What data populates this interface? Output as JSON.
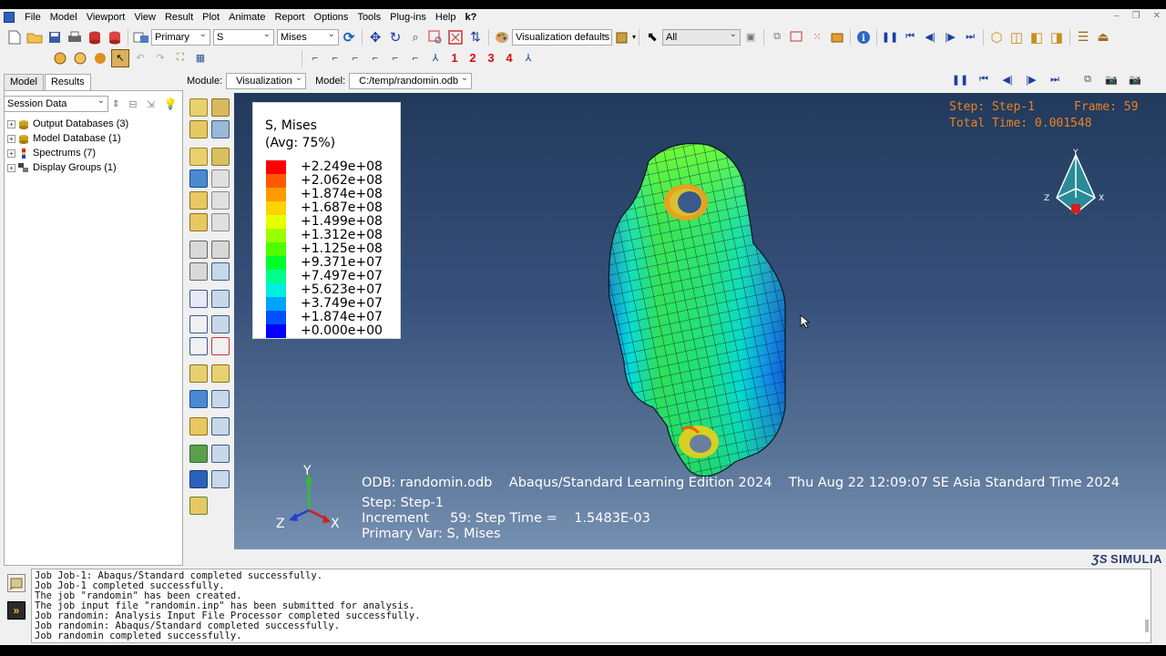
{
  "menu": [
    "File",
    "Model",
    "Viewport",
    "View",
    "Result",
    "Plot",
    "Animate",
    "Report",
    "Options",
    "Tools",
    "Plug-ins",
    "Help"
  ],
  "toolbar": {
    "primary_select": "Primary",
    "variable_select": "S",
    "invariant_select": "Mises",
    "viz_defaults": "Visualization defaults",
    "selection_filter": "All",
    "red_numbers": [
      "1",
      "2",
      "3",
      "4"
    ]
  },
  "left_tabs": {
    "model": "Model",
    "results": "Results"
  },
  "session_select": "Session Data",
  "tree": [
    {
      "label": "Output Databases (3)",
      "icon": "database-icon"
    },
    {
      "label": "Model Database (1)",
      "icon": "database-icon"
    },
    {
      "label": "Spectrums (7)",
      "icon": "spectrum-icon"
    },
    {
      "label": "Display Groups (1)",
      "icon": "display-groups-icon"
    }
  ],
  "module_row": {
    "module_label": "Module:",
    "module_value": "Visualization",
    "model_label": "Model:",
    "model_value": "C:/temp/randomin.odb"
  },
  "legend": {
    "title": "S, Mises",
    "subtitle": "(Avg: 75%)",
    "entries": [
      {
        "value": "+2.249e+08",
        "color": "#ff0000"
      },
      {
        "value": "+2.062e+08",
        "color": "#ff5a00"
      },
      {
        "value": "+1.874e+08",
        "color": "#ff9a00"
      },
      {
        "value": "+1.687e+08",
        "color": "#ffd200"
      },
      {
        "value": "+1.499e+08",
        "color": "#e6ff00"
      },
      {
        "value": "+1.312e+08",
        "color": "#9cff00"
      },
      {
        "value": "+1.125e+08",
        "color": "#4dff00"
      },
      {
        "value": "+9.371e+07",
        "color": "#00ff2a"
      },
      {
        "value": "+7.497e+07",
        "color": "#00ff8a"
      },
      {
        "value": "+5.623e+07",
        "color": "#00f0e0"
      },
      {
        "value": "+3.749e+07",
        "color": "#00a4ff"
      },
      {
        "value": "+1.874e+07",
        "color": "#0050ff"
      },
      {
        "value": "+0.000e+00",
        "color": "#0000ff"
      }
    ]
  },
  "step_info": {
    "step": "Step: Step-1",
    "frame": "Frame: 59",
    "total_time": "Total Time: 0.001548"
  },
  "triad_small": {
    "y": "Y",
    "z": "Z",
    "x": "X"
  },
  "triad": {
    "y": "Y",
    "z": "Z",
    "x": "X"
  },
  "odb_line": "ODB: randomin.odb    Abaqus/Standard Learning Edition 2024    Thu Aug 22 12:09:07 SE Asia Standard Time 2024",
  "step_line": "Step: Step-1",
  "increment_line": "Increment     59: Step Time =    1.5483E-03",
  "primary_var_line": "Primary Var: S, Mises",
  "brand": "SIMULIA",
  "messages": [
    "Job Job-1: Abaqus/Standard completed successfully.",
    "Job Job-1 completed successfully.",
    "The job \"randomin\" has been created.",
    "The job input file \"randomin.inp\" has been submitted for analysis.",
    "Job randomin: Analysis Input File Processor completed successfully.",
    "Job randomin: Abaqus/Standard completed successfully.",
    "Job randomin completed successfully."
  ]
}
